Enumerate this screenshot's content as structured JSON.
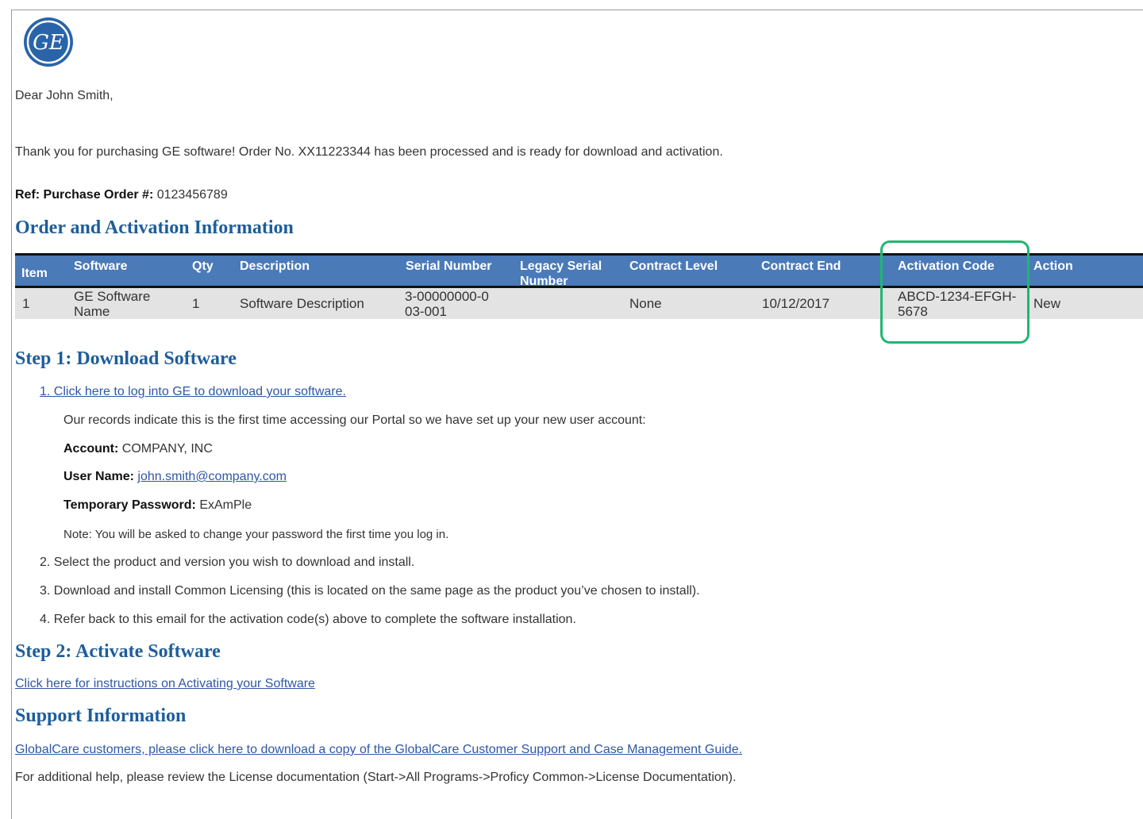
{
  "greeting": "Dear John Smith,",
  "intro": "Thank you for purchasing GE software! Order No. XX11223344 has been processed and is ready for download and activation.",
  "ref": {
    "label": "Ref: Purchase Order #:",
    "value": "0123456789"
  },
  "order_section": {
    "title": "Order and Activation Information",
    "columns": [
      "Item",
      "Software",
      "Qty",
      "Description",
      "Serial Number",
      "Legacy Serial Number",
      "Contract Level",
      "Contract End",
      "Activation Code",
      "Action"
    ],
    "row": {
      "item": "1",
      "software": "GE Software Name",
      "qty": "1",
      "description": "Software Description",
      "serial_number": "3-00000000-003-001",
      "legacy_serial": "",
      "contract_level": "None",
      "contract_end": "10/12/2017",
      "activation_code": "ABCD-1234-EFGH-5678",
      "action": "New"
    }
  },
  "step1": {
    "title": "Step 1: Download Software",
    "link": "1. Click here to log into GE to download your software.",
    "records_note": "Our records indicate this is the first time accessing our Portal so we have set up your new user account:",
    "account_label": "Account:",
    "account_value": "COMPANY, INC",
    "username_label": "User Name:",
    "username_value": "john.smith@company.com",
    "password_label": "Temporary Password:",
    "password_value": "ExAmPle",
    "password_note": "Note: You will be asked to change your password the first time you log in.",
    "item2": "2. Select the product and version you wish to download and install.",
    "item3": "3. Download and install Common Licensing (this is located on the same page as the product you’ve chosen to install).",
    "item4": "4. Refer back to this email for the activation code(s) above to complete the software installation."
  },
  "step2": {
    "title": "Step 2: Activate Software",
    "link": "Click here for instructions on Activating your Software"
  },
  "support": {
    "title": "Support Information",
    "link": "GlobalCare customers, please click here to download a copy of the GlobalCare Customer Support and Case Management Guide.",
    "help": "For additional help, please review the License documentation (Start->All Programs->Proficy Common->License Documentation)."
  },
  "colors": {
    "heading": "#1d5d9b",
    "table_header": "#4a7ab8",
    "highlight": "#1fb771",
    "link": "#2f57a6"
  }
}
